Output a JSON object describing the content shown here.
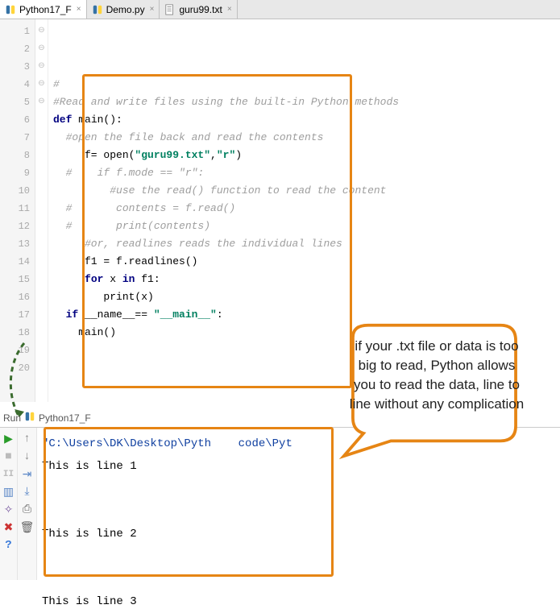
{
  "tabs": [
    {
      "label": "Python17_F",
      "type": "py",
      "active": true
    },
    {
      "label": "Demo.py",
      "type": "py",
      "active": false
    },
    {
      "label": "guru99.txt",
      "type": "txt",
      "active": false
    }
  ],
  "code": {
    "lines": [
      {
        "n": 1,
        "raw": "#",
        "cls": "cmt"
      },
      {
        "n": 2,
        "raw": "#Read and write files using the built-in Python methods",
        "cls": "cmt"
      },
      {
        "n": 3,
        "raw": ""
      },
      {
        "n": 4,
        "segments": [
          {
            "t": "def ",
            "c": "kw"
          },
          {
            "t": "main():",
            "c": ""
          }
        ]
      },
      {
        "n": 5,
        "raw": ""
      },
      {
        "n": 6,
        "raw": "  #open the file back and read the contents",
        "cls": "cmt"
      },
      {
        "n": 7,
        "segments": [
          {
            "t": "     f= open(",
            "c": ""
          },
          {
            "t": "\"guru99.txt\"",
            "c": "str"
          },
          {
            "t": ",",
            "c": ""
          },
          {
            "t": "\"r\"",
            "c": "str"
          },
          {
            "t": ")",
            "c": ""
          }
        ]
      },
      {
        "n": 8,
        "raw": "  #    if f.mode == \"r\":",
        "cls": "cmt"
      },
      {
        "n": 9,
        "raw": "         #use the read() function to read the content",
        "cls": "cmt"
      },
      {
        "n": 10,
        "raw": "  #       contents = f.read()",
        "cls": "cmt"
      },
      {
        "n": 11,
        "raw": "  #       print(contents)",
        "cls": "cmt"
      },
      {
        "n": 12,
        "raw": ""
      },
      {
        "n": 13,
        "raw": "     #or, readlines reads the individual lines",
        "cls": "cmt"
      },
      {
        "n": 14,
        "raw": "     f1 = f.readlines()"
      },
      {
        "n": 15,
        "segments": [
          {
            "t": "     ",
            "c": ""
          },
          {
            "t": "for",
            "c": "kw"
          },
          {
            "t": " x ",
            "c": ""
          },
          {
            "t": "in",
            "c": "kw"
          },
          {
            "t": " f1:",
            "c": ""
          }
        ]
      },
      {
        "n": 16,
        "raw": "        print(x)"
      },
      {
        "n": 17,
        "raw": ""
      },
      {
        "n": 18,
        "segments": [
          {
            "t": "  ",
            "c": ""
          },
          {
            "t": "if",
            "c": "kw"
          },
          {
            "t": " __name__== ",
            "c": ""
          },
          {
            "t": "\"__main__\"",
            "c": "mainstr"
          },
          {
            "t": ":",
            "c": ""
          }
        ]
      },
      {
        "n": 19,
        "raw": "    main()"
      },
      {
        "n": 20,
        "raw": ""
      }
    ]
  },
  "run": {
    "label_prefix": "Run",
    "config": "Python17_F",
    "path": "\"C:\\Users\\DK\\Desktop\\Pyth    code\\Pyt",
    "lines": [
      "This is line 1",
      "",
      "",
      "This is line 2",
      "",
      "",
      "This is line 3"
    ]
  },
  "annotation": "if your .txt file or data is too big to read, Python allows you to read the data, line to line without any complication"
}
